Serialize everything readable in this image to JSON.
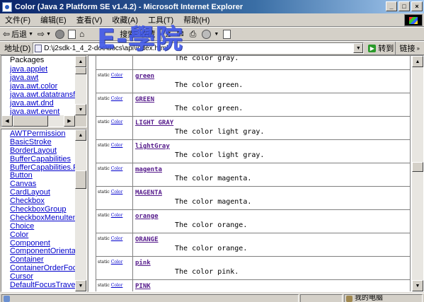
{
  "window": {
    "title": "Color (Java 2 Platform SE v1.4.2) - Microsoft Internet Explorer",
    "buttons": [
      "_",
      "□",
      "×"
    ]
  },
  "menubar": {
    "items": [
      "文件(F)",
      "编辑(E)",
      "查看(V)",
      "收藏(A)",
      "工具(T)",
      "帮助(H)"
    ]
  },
  "toolbar": {
    "back_label": "后退",
    "search_label": "搜索",
    "favorites_label": "收藏"
  },
  "addressbar": {
    "label": "地址(D)",
    "url": "D:\\j2sdk-1_4_2-doc\\docs\\api\\index.html",
    "go_label": "转到",
    "links_label": "链接"
  },
  "watermark": {
    "text": "E-學院"
  },
  "package_frame": {
    "title": "Packages",
    "items": [
      "java.applet",
      "java.awt",
      "java.awt.color",
      "java.awt.datatransfe",
      "java.awt.dnd",
      "java.awt.event"
    ]
  },
  "class_frame": {
    "items": [
      "AWTPermission",
      "BasicStroke",
      "BorderLayout",
      "BufferCapabilities",
      "BufferCapabilities.Fl",
      "Button",
      "Canvas",
      "CardLayout",
      "Checkbox",
      "CheckboxGroup",
      "CheckboxMenuItem",
      "Choice",
      "Color",
      "Component",
      "ComponentOrientati",
      "Container",
      "ContainerOrderFocu",
      "Cursor",
      "DefaultFocusTravers"
    ]
  },
  "main_frame": {
    "modifier": "static",
    "type": "Color",
    "fields": [
      {
        "name": "",
        "desc": "The color gray."
      },
      {
        "name": "green",
        "desc": "The color green."
      },
      {
        "name": "GREEN",
        "desc": "The color green."
      },
      {
        "name": "LIGHT_GRAY",
        "desc": "The color light gray."
      },
      {
        "name": "lightGray",
        "desc": "The color light gray."
      },
      {
        "name": "magenta",
        "desc": "The color magenta."
      },
      {
        "name": "MAGENTA",
        "desc": "The color magenta."
      },
      {
        "name": "orange",
        "desc": "The color orange."
      },
      {
        "name": "ORANGE",
        "desc": "The color orange."
      },
      {
        "name": "pink",
        "desc": "The color pink."
      },
      {
        "name": "PINK",
        "desc": ""
      }
    ]
  },
  "statusbar": {
    "zone_text": "我的电脑"
  }
}
